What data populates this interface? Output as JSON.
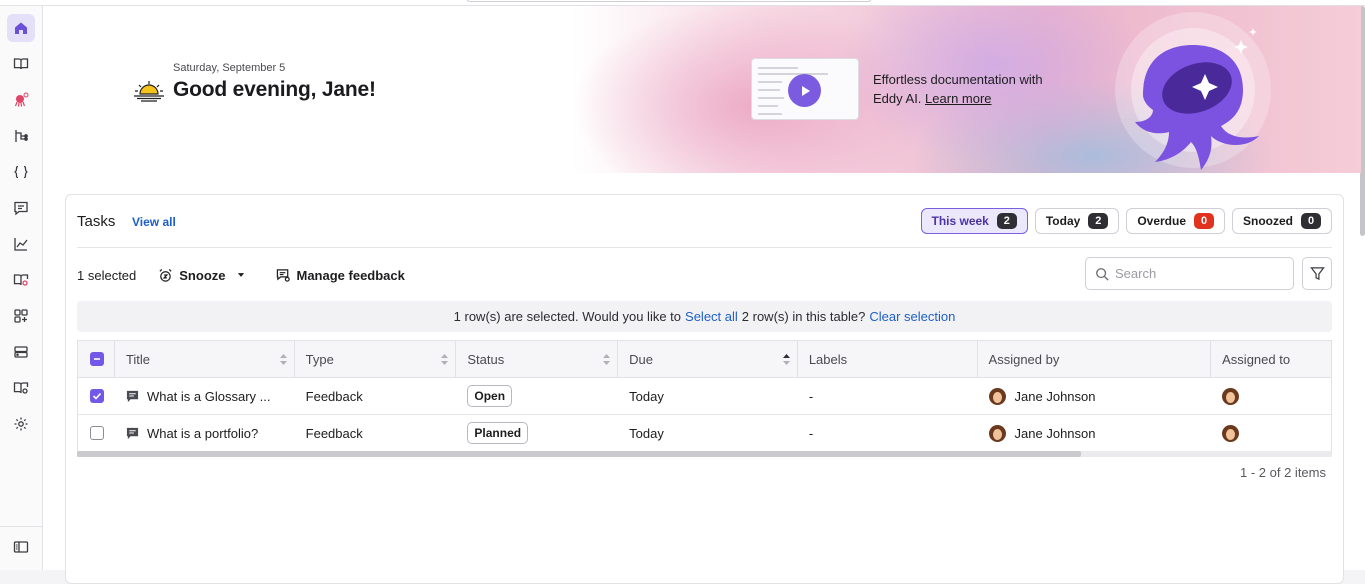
{
  "sidebar": {
    "items": [
      {
        "icon": "home-icon"
      },
      {
        "icon": "book-icon"
      },
      {
        "icon": "octopus-ai-icon"
      },
      {
        "icon": "branch-icon"
      },
      {
        "icon": "code-braces-icon"
      },
      {
        "icon": "chat-icon"
      },
      {
        "icon": "analytics-icon"
      },
      {
        "icon": "book-search-icon"
      },
      {
        "icon": "apps-icon"
      },
      {
        "icon": "storage-icon"
      },
      {
        "icon": "book-settings-icon"
      },
      {
        "icon": "gear-icon"
      }
    ],
    "bottom_icon": "collapse-sidebar-icon"
  },
  "hero": {
    "date": "Saturday, September 5",
    "greeting": "Good evening, Jane!",
    "promo_text": "Effortless documentation with Eddy AI.",
    "promo_link": "Learn more"
  },
  "tasks": {
    "title": "Tasks",
    "view_all": "View all",
    "tabs": [
      {
        "label": "This week",
        "count": "2"
      },
      {
        "label": "Today",
        "count": "2"
      },
      {
        "label": "Overdue",
        "count": "0"
      },
      {
        "label": "Snoozed",
        "count": "0"
      }
    ],
    "selected_text": "1 selected",
    "snooze_label": "Snooze",
    "manage_label": "Manage feedback",
    "search_placeholder": "Search",
    "banner": {
      "prefix": "1 row(s) are selected. Would you like to",
      "select_all": "Select all",
      "middle": "2 row(s) in this table?",
      "clear": "Clear selection"
    },
    "columns": [
      "Title",
      "Type",
      "Status",
      "Due",
      "Labels",
      "Assigned by",
      "Assigned to"
    ],
    "rows": [
      {
        "title": "What is a Glossary ...",
        "type": "Feedback",
        "status": "Open",
        "due": "Today",
        "labels": "-",
        "assigned_by": "Jane Johnson"
      },
      {
        "title": "What is a portfolio?",
        "type": "Feedback",
        "status": "Planned",
        "due": "Today",
        "labels": "-",
        "assigned_by": "Jane Johnson"
      }
    ],
    "pager": "1 - 2 of 2 items"
  },
  "colors": {
    "accent": "#7357e6",
    "link": "#1d5fc8",
    "overdue": "#e0321f"
  }
}
